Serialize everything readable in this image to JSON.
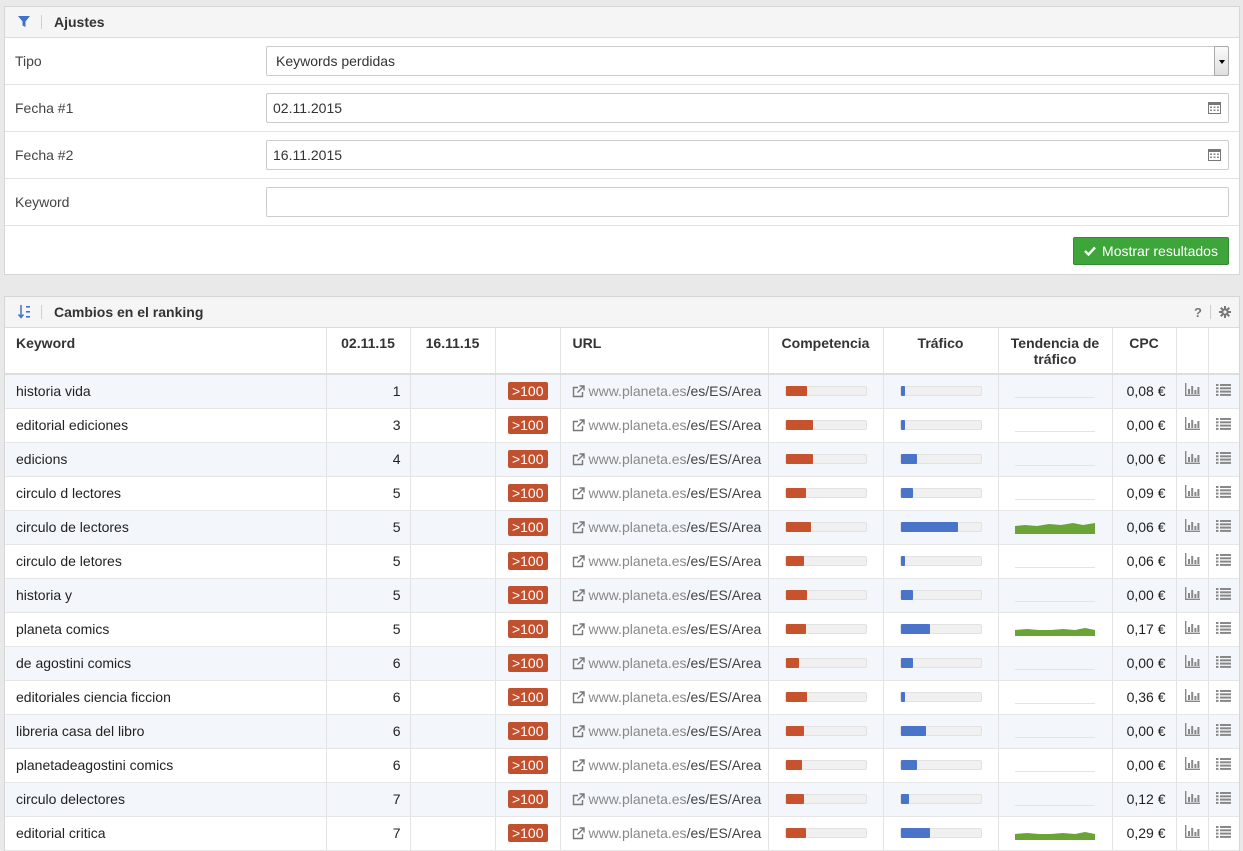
{
  "settings": {
    "title": "Ajustes",
    "tipo_label": "Tipo",
    "tipo_value": "Keywords perdidas",
    "fecha1_label": "Fecha #1",
    "fecha1_value": "02.11.2015",
    "fecha2_label": "Fecha #2",
    "fecha2_value": "16.11.2015",
    "keyword_label": "Keyword",
    "keyword_value": "",
    "submit_label": "Mostrar resultados"
  },
  "ranking": {
    "title": "Cambios en el ranking",
    "help": "?",
    "columns": {
      "keyword": "Keyword",
      "date1": "02.11.15",
      "date2": "16.11.15",
      "url": "URL",
      "competencia": "Competencia",
      "trafico": "Tráfico",
      "tendencia": "Tendencia de tráfico",
      "cpc": "CPC"
    },
    "rows": [
      {
        "keyword": "historia vida",
        "pos1": "1",
        "badge": ">100",
        "url_domain": "www.planeta.es",
        "url_path": "/es/ES/Area",
        "competencia": 0.25,
        "trafico": 0.05,
        "trend": "none",
        "cpc": "0,08 €"
      },
      {
        "keyword": "editorial ediciones",
        "pos1": "3",
        "badge": ">100",
        "url_domain": "www.planeta.es",
        "url_path": "/es/ES/Area",
        "competencia": 0.33,
        "trafico": 0.05,
        "trend": "none",
        "cpc": "0,00 €"
      },
      {
        "keyword": "edicions",
        "pos1": "4",
        "badge": ">100",
        "url_domain": "www.planeta.es",
        "url_path": "/es/ES/Area",
        "competencia": 0.33,
        "trafico": 0.2,
        "trend": "none",
        "cpc": "0,00 €"
      },
      {
        "keyword": "circulo d lectores",
        "pos1": "5",
        "badge": ">100",
        "url_domain": "www.planeta.es",
        "url_path": "/es/ES/Area",
        "competencia": 0.24,
        "trafico": 0.15,
        "trend": "none",
        "cpc": "0,09 €"
      },
      {
        "keyword": "circulo de lectores",
        "pos1": "5",
        "badge": ">100",
        "url_domain": "www.planeta.es",
        "url_path": "/es/ES/Area",
        "competencia": 0.3,
        "trafico": 0.7,
        "trend": "full",
        "cpc": "0,06 €"
      },
      {
        "keyword": "circulo de letores",
        "pos1": "5",
        "badge": ">100",
        "url_domain": "www.planeta.es",
        "url_path": "/es/ES/Area",
        "competencia": 0.22,
        "trafico": 0.05,
        "trend": "none",
        "cpc": "0,06 €"
      },
      {
        "keyword": "historia y",
        "pos1": "5",
        "badge": ">100",
        "url_domain": "www.planeta.es",
        "url_path": "/es/ES/Area",
        "competencia": 0.25,
        "trafico": 0.15,
        "trend": "none",
        "cpc": "0,00 €"
      },
      {
        "keyword": "planeta comics",
        "pos1": "5",
        "badge": ">100",
        "url_domain": "www.planeta.es",
        "url_path": "/es/ES/Area",
        "competencia": 0.24,
        "trafico": 0.35,
        "trend": "medium",
        "cpc": "0,17 €"
      },
      {
        "keyword": "de agostini comics",
        "pos1": "6",
        "badge": ">100",
        "url_domain": "www.planeta.es",
        "url_path": "/es/ES/Area",
        "competencia": 0.16,
        "trafico": 0.15,
        "trend": "none",
        "cpc": "0,00 €"
      },
      {
        "keyword": "editoriales ciencia ficcion",
        "pos1": "6",
        "badge": ">100",
        "url_domain": "www.planeta.es",
        "url_path": "/es/ES/Area",
        "competencia": 0.25,
        "trafico": 0.05,
        "trend": "none",
        "cpc": "0,36 €"
      },
      {
        "keyword": "libreria casa del libro",
        "pos1": "6",
        "badge": ">100",
        "url_domain": "www.planeta.es",
        "url_path": "/es/ES/Area",
        "competencia": 0.22,
        "trafico": 0.3,
        "trend": "none",
        "cpc": "0,00 €"
      },
      {
        "keyword": "planetadeagostini comics",
        "pos1": "6",
        "badge": ">100",
        "url_domain": "www.planeta.es",
        "url_path": "/es/ES/Area",
        "competencia": 0.2,
        "trafico": 0.2,
        "trend": "none",
        "cpc": "0,00 €"
      },
      {
        "keyword": "circulo delectores",
        "pos1": "7",
        "badge": ">100",
        "url_domain": "www.planeta.es",
        "url_path": "/es/ES/Area",
        "competencia": 0.22,
        "trafico": 0.1,
        "trend": "none",
        "cpc": "0,12 €"
      },
      {
        "keyword": "editorial critica",
        "pos1": "7",
        "badge": ">100",
        "url_domain": "www.planeta.es",
        "url_path": "/es/ES/Area",
        "competencia": 0.24,
        "trafico": 0.35,
        "trend": "medium",
        "cpc": "0,29 €"
      }
    ]
  },
  "colors": {
    "badge": "#c0502e",
    "competencia_bar": "#c7522e",
    "trafico_bar": "#4a74c9",
    "trend_fill": "#6aa336",
    "submit_button": "#3ea53a"
  },
  "icons": {
    "settings_header": "filter-icon",
    "ranking_header": "sort-icon",
    "url": "external-link-icon",
    "row_chart": "bar-chart-icon",
    "row_list": "list-icon"
  }
}
